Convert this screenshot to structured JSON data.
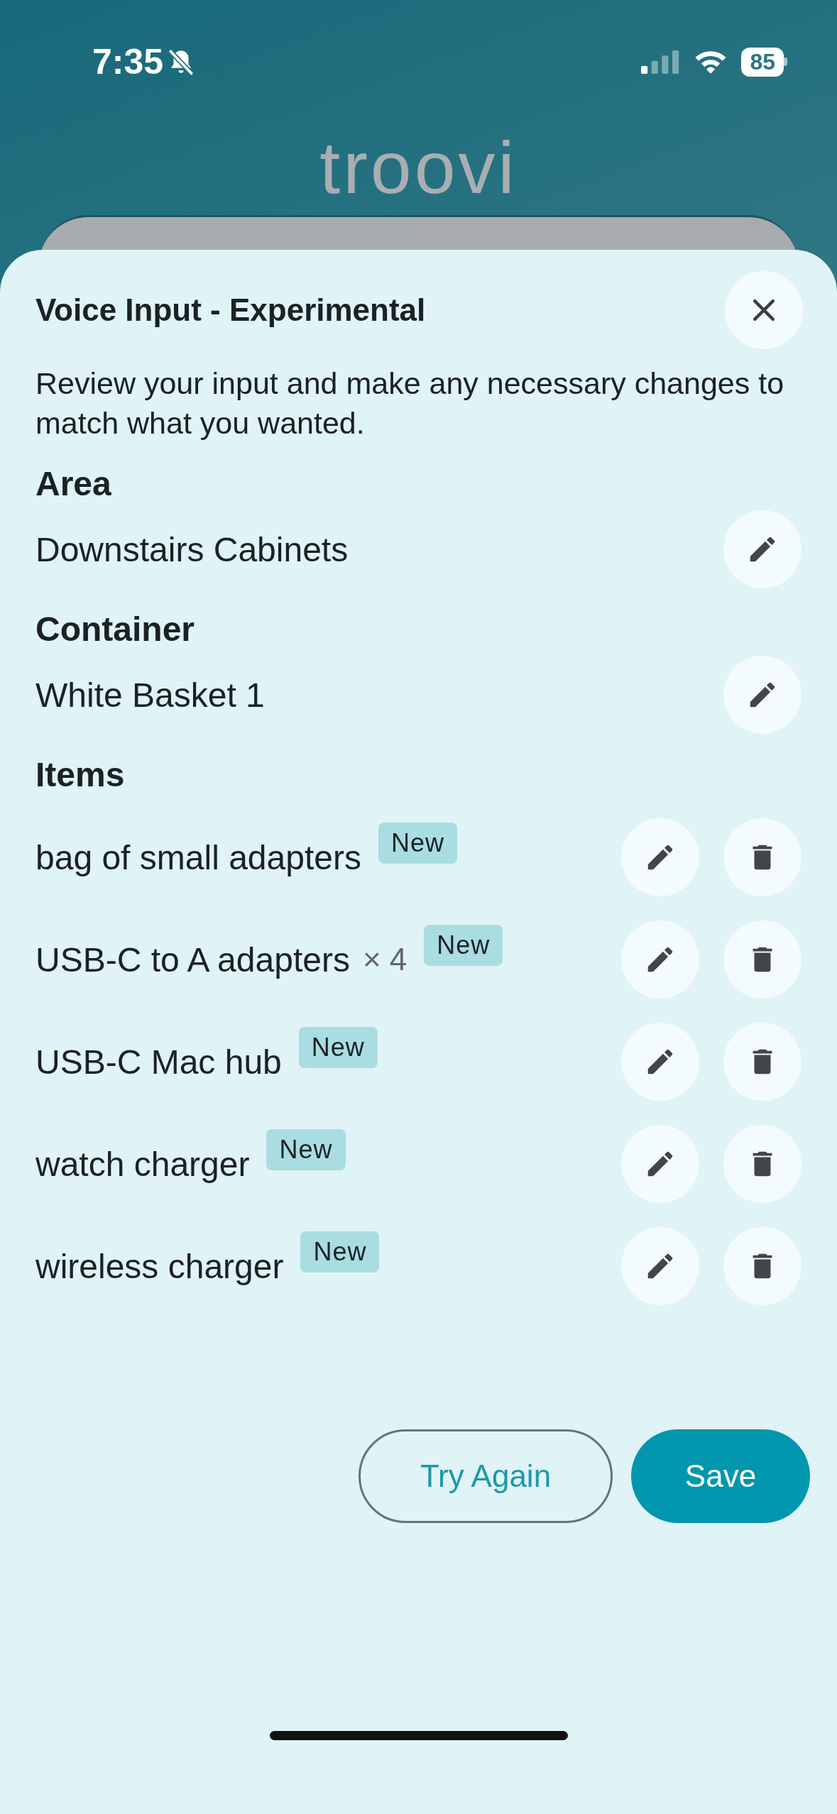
{
  "status_bar": {
    "time": "7:35",
    "silent": true,
    "battery": "85"
  },
  "app": {
    "logo": "troovi"
  },
  "sheet": {
    "title": "Voice Input - Experimental",
    "description": "Review your input and make any necessary changes to match what you wanted.",
    "sections": [
      {
        "heading": "Area",
        "value": "Downstairs Cabinets"
      },
      {
        "heading": "Container",
        "value": "White Basket 1"
      }
    ],
    "items_heading": "Items",
    "items": [
      {
        "name": "bag of small adapters",
        "badge": "New"
      },
      {
        "name": "USB-C to A adapters",
        "quantity": "× 4",
        "badge": "New"
      },
      {
        "name": "USB-C Mac hub",
        "badge": "New"
      },
      {
        "name": "watch charger",
        "badge": "New"
      },
      {
        "name": "wireless charger",
        "badge": "New"
      }
    ],
    "buttons": [
      {
        "label": "Try Again",
        "kind": "secondary"
      },
      {
        "label": "Save",
        "kind": "primary"
      }
    ]
  }
}
